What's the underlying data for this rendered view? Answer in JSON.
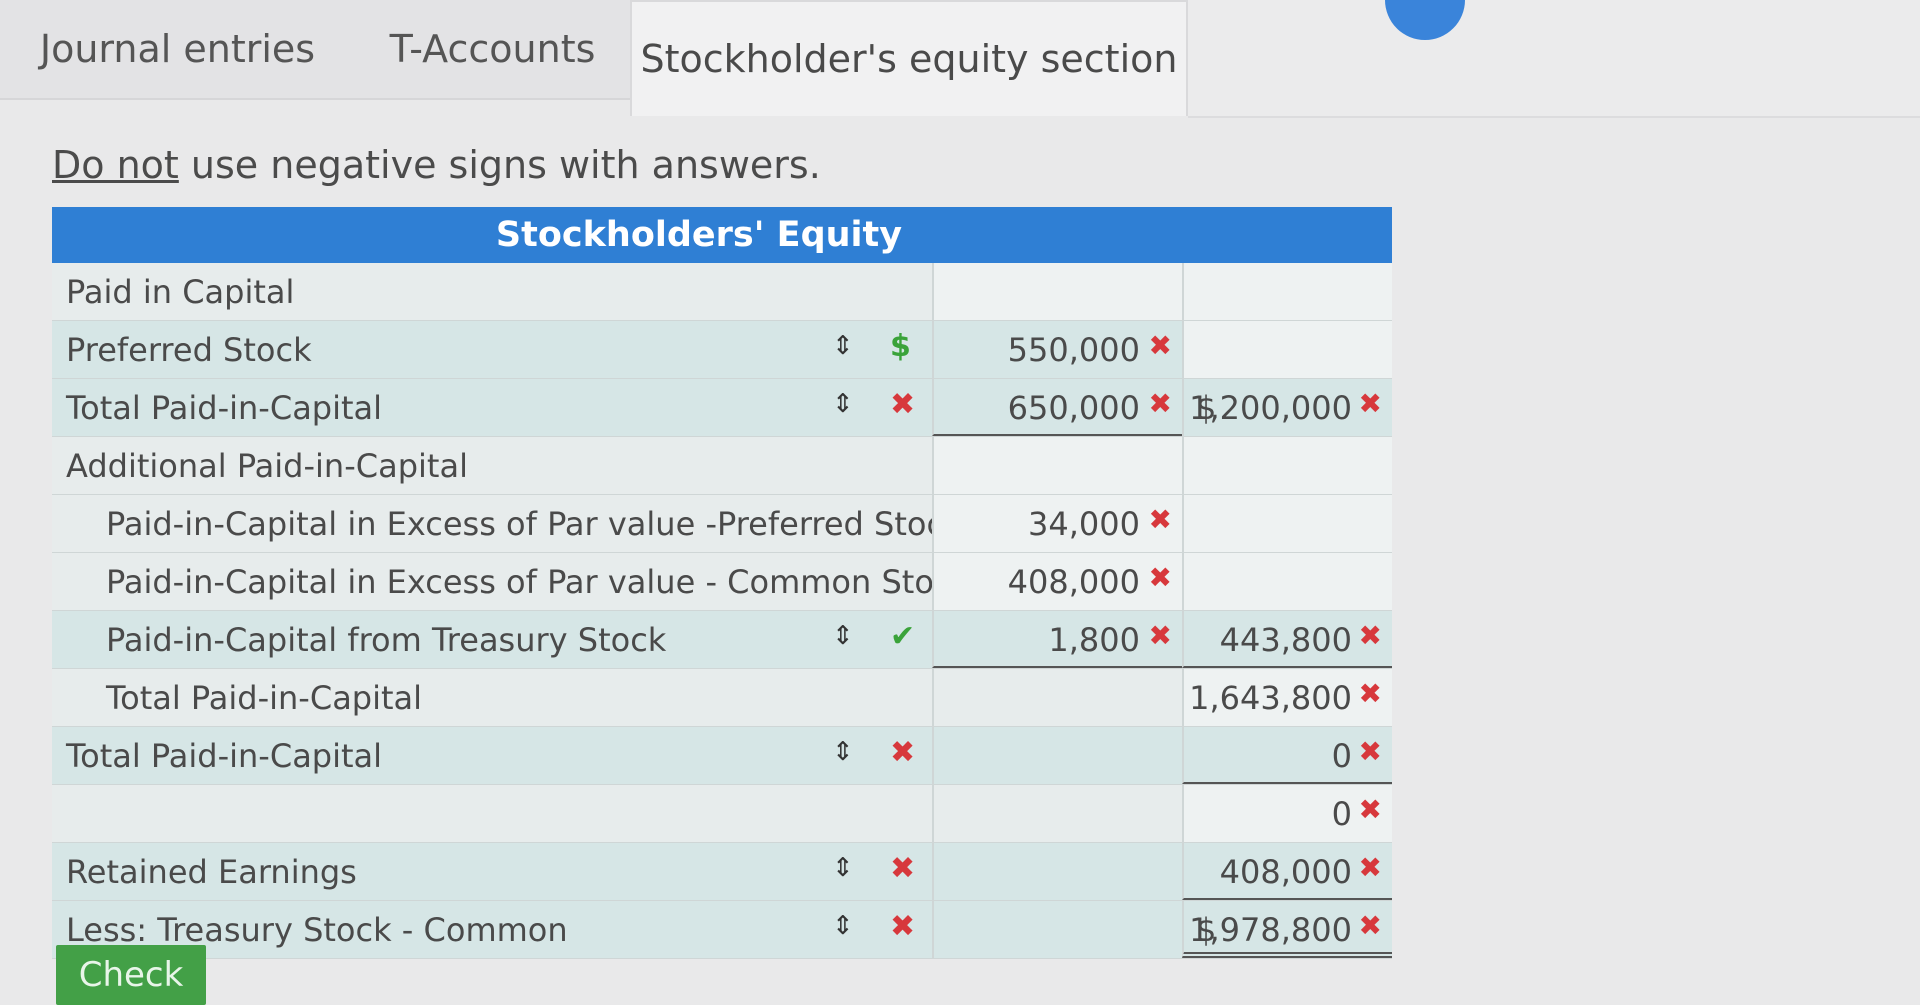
{
  "tabs": [
    {
      "label": "Journal entries"
    },
    {
      "label": "T-Accounts"
    },
    {
      "label": "Stockholder's equity section"
    }
  ],
  "instruction": {
    "emphasis": "Do not",
    "rest": " use negative signs with answers."
  },
  "table": {
    "title": "Stockholders' Equity",
    "rows": [
      {
        "label": "Paid in Capital",
        "col1": "",
        "col2": ""
      },
      {
        "label": "Preferred Stock",
        "col1": "550,000",
        "col2": ""
      },
      {
        "label": "Total Paid-in-Capital",
        "col1": "650,000",
        "col2": "1,200,000",
        "col2_dollar": "$"
      },
      {
        "label": "Additional Paid-in-Capital",
        "col1": "",
        "col2": ""
      },
      {
        "label": "Paid-in-Capital in Excess of Par value -Preferred Stock",
        "col1": "34,000",
        "col2": ""
      },
      {
        "label": "Paid-in-Capital in Excess of Par value - Common Stock",
        "col1": "408,000",
        "col2": ""
      },
      {
        "label": "Paid-in-Capital from Treasury Stock",
        "col1": "1,800",
        "col2": "443,800"
      },
      {
        "label": "Total Paid-in-Capital",
        "col1": "",
        "col2": "1,643,800"
      },
      {
        "label": "Total Paid-in-Capital",
        "col1": "",
        "col2": "0"
      },
      {
        "label": "",
        "col1": "",
        "col2": "0"
      },
      {
        "label": "Retained Earnings",
        "col1": "",
        "col2": "408,000"
      },
      {
        "label": "Less: Treasury Stock - Common",
        "col1": "",
        "col2": "1,978,800",
        "col2_dollar": "$"
      }
    ]
  },
  "icons": {
    "sort": "sort-arrows-icon",
    "wrong": "x-mark-icon",
    "right": "check-mark-icon"
  },
  "symbols": {
    "sort": "⇕",
    "x": "✖",
    "check": "✔",
    "dollar": "$"
  },
  "colors": {
    "header": "#2f7fd4",
    "wrong": "#d7383c",
    "correct": "#3aa33a",
    "button": "#43a047"
  },
  "check_button": {
    "label": "Check"
  }
}
